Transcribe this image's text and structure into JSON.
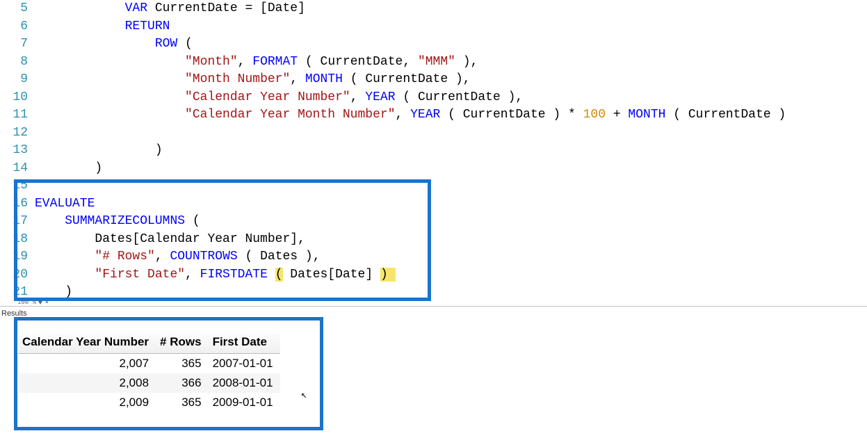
{
  "editor": {
    "first_line_number": 5,
    "zoom_label": "100 %",
    "code_lines": [
      [
        [
          "pad",
          "            "
        ],
        [
          "kw-var",
          "VAR"
        ],
        [
          "txt",
          " CurrentDate = [Date]"
        ]
      ],
      [
        [
          "pad",
          "            "
        ],
        [
          "kw-ret",
          "RETURN"
        ]
      ],
      [
        [
          "pad",
          "                "
        ],
        [
          "kw-func",
          "ROW"
        ],
        [
          "txt",
          " "
        ],
        [
          "paren",
          "("
        ]
      ],
      [
        [
          "pad",
          "                    "
        ],
        [
          "str",
          "\"Month\""
        ],
        [
          "txt",
          ", "
        ],
        [
          "kw-func",
          "FORMAT"
        ],
        [
          "txt",
          " "
        ],
        [
          "paren",
          "("
        ],
        [
          "txt",
          " CurrentDate, "
        ],
        [
          "str",
          "\"MMM\""
        ],
        [
          "txt",
          " "
        ],
        [
          "paren",
          ")"
        ],
        [
          "txt",
          ","
        ]
      ],
      [
        [
          "pad",
          "                    "
        ],
        [
          "str",
          "\"Month Number\""
        ],
        [
          "txt",
          ", "
        ],
        [
          "kw-func",
          "MONTH"
        ],
        [
          "txt",
          " "
        ],
        [
          "paren",
          "("
        ],
        [
          "txt",
          " CurrentDate "
        ],
        [
          "paren",
          ")"
        ],
        [
          "txt",
          ","
        ]
      ],
      [
        [
          "pad",
          "                    "
        ],
        [
          "str",
          "\"Calendar Year Number\""
        ],
        [
          "txt",
          ", "
        ],
        [
          "kw-func",
          "YEAR"
        ],
        [
          "txt",
          " "
        ],
        [
          "paren",
          "("
        ],
        [
          "txt",
          " CurrentDate "
        ],
        [
          "paren",
          ")"
        ],
        [
          "txt",
          ","
        ]
      ],
      [
        [
          "pad",
          "                    "
        ],
        [
          "str",
          "\"Calendar Year Month Number\""
        ],
        [
          "txt",
          ", "
        ],
        [
          "kw-func",
          "YEAR"
        ],
        [
          "txt",
          " "
        ],
        [
          "paren",
          "("
        ],
        [
          "txt",
          " CurrentDate "
        ],
        [
          "paren",
          ")"
        ],
        [
          "txt",
          " * "
        ],
        [
          "num",
          "100"
        ],
        [
          "txt",
          " + "
        ],
        [
          "kw-func",
          "MONTH"
        ],
        [
          "txt",
          " "
        ],
        [
          "paren",
          "("
        ],
        [
          "txt",
          " CurrentDate "
        ],
        [
          "paren",
          ")"
        ]
      ],
      [
        [
          "txt",
          ""
        ]
      ],
      [
        [
          "pad",
          "                "
        ],
        [
          "paren",
          ")"
        ]
      ],
      [
        [
          "pad",
          "        "
        ],
        [
          "paren",
          ")"
        ]
      ],
      [
        [
          "txt",
          ""
        ]
      ],
      [
        [
          "kw-eval",
          "EVALUATE"
        ]
      ],
      [
        [
          "pad",
          "    "
        ],
        [
          "kw-func",
          "SUMMARIZECOLUMNS"
        ],
        [
          "txt",
          " "
        ],
        [
          "paren",
          "("
        ]
      ],
      [
        [
          "pad",
          "        "
        ],
        [
          "txt",
          "Dates[Calendar Year Number],"
        ]
      ],
      [
        [
          "pad",
          "        "
        ],
        [
          "str",
          "\"# Rows\""
        ],
        [
          "txt",
          ", "
        ],
        [
          "kw-func",
          "COUNTROWS"
        ],
        [
          "txt",
          " "
        ],
        [
          "paren",
          "("
        ],
        [
          "txt",
          " Dates "
        ],
        [
          "paren",
          ")"
        ],
        [
          "txt",
          ","
        ]
      ],
      [
        [
          "pad",
          "        "
        ],
        [
          "str",
          "\"First Date\""
        ],
        [
          "txt",
          ", "
        ],
        [
          "kw-func",
          "FIRSTDATE"
        ],
        [
          "txt",
          " "
        ],
        [
          "brmatch",
          "("
        ],
        [
          "txt",
          " Dates[Date] "
        ],
        [
          "brmatch",
          ")"
        ],
        [
          "cursor",
          " "
        ]
      ],
      [
        [
          "pad",
          "    "
        ],
        [
          "paren",
          ")"
        ]
      ]
    ]
  },
  "results": {
    "panel_label": "Results",
    "columns": [
      "Calendar Year Number",
      "# Rows",
      "First Date"
    ],
    "column_align": [
      "right",
      "right",
      "left"
    ],
    "rows": [
      [
        "2,007",
        "365",
        "2007-01-01"
      ],
      [
        "2,008",
        "366",
        "2008-01-01"
      ],
      [
        "2,009",
        "365",
        "2009-01-01"
      ]
    ]
  },
  "chart_data": {
    "type": "table",
    "title": "Results",
    "columns": [
      "Calendar Year Number",
      "# Rows",
      "First Date"
    ],
    "rows": [
      {
        "Calendar Year Number": 2007,
        "# Rows": 365,
        "First Date": "2007-01-01"
      },
      {
        "Calendar Year Number": 2008,
        "# Rows": 366,
        "First Date": "2008-01-01"
      },
      {
        "Calendar Year Number": 2009,
        "# Rows": 365,
        "First Date": "2009-01-01"
      }
    ]
  }
}
